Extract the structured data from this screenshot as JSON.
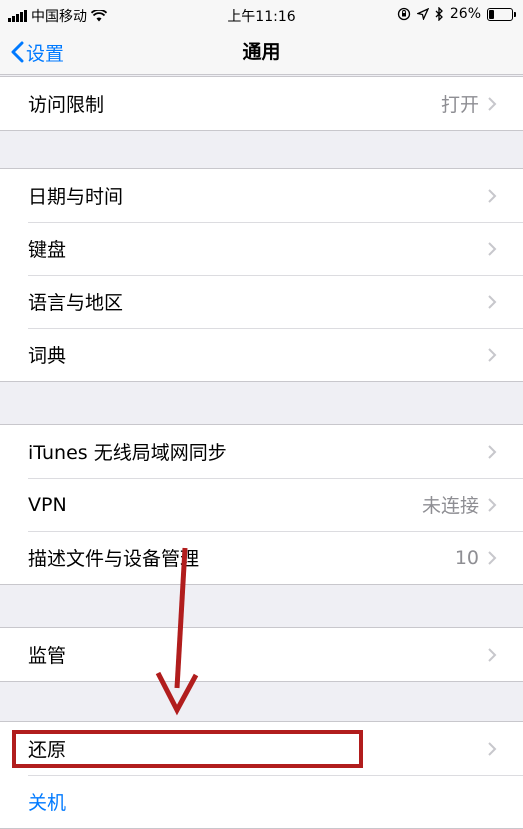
{
  "status_bar": {
    "carrier": "中国移动",
    "time": "上午11:16",
    "battery_text": "26%",
    "battery_level": 0.26,
    "icons": [
      "signal-icon",
      "wifi-icon",
      "orientation-lock-icon",
      "location-icon",
      "bluetooth-icon",
      "battery-icon"
    ]
  },
  "nav": {
    "back_label": "设置",
    "title": "通用"
  },
  "groups": [
    {
      "items": [
        {
          "label": "访问限制",
          "value": "打开"
        }
      ]
    },
    {
      "items": [
        {
          "label": "日期与时间",
          "value": ""
        },
        {
          "label": "键盘",
          "value": ""
        },
        {
          "label": "语言与地区",
          "value": ""
        },
        {
          "label": "词典",
          "value": ""
        }
      ]
    },
    {
      "items": [
        {
          "label": "iTunes 无线局域网同步",
          "value": ""
        },
        {
          "label": "VPN",
          "value": "未连接"
        },
        {
          "label": "描述文件与设备管理",
          "value": "10"
        }
      ]
    },
    {
      "items": [
        {
          "label": "监管",
          "value": ""
        }
      ]
    },
    {
      "items": [
        {
          "label": "还原",
          "value": ""
        },
        {
          "label": "关机",
          "value": ""
        }
      ]
    }
  ],
  "colors": {
    "accent": "#007aff",
    "annotation": "#b11d1d",
    "background": "#efeff4",
    "secondary_text": "#8e8e93"
  }
}
